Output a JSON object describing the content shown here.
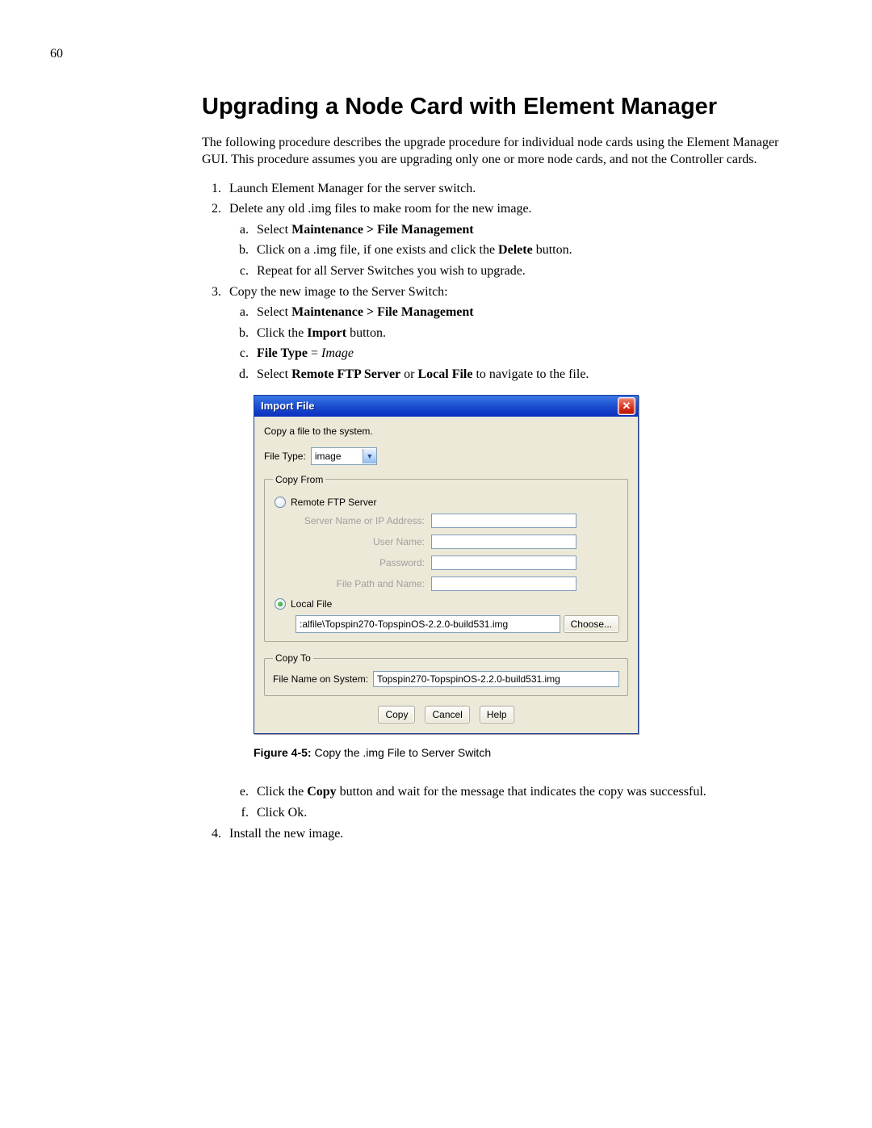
{
  "page_number": "60",
  "heading": "Upgrading a Node Card with Element Manager",
  "intro": "The following procedure describes the upgrade procedure for individual node cards using the Element Manager GUI. This procedure assumes you are upgrading only one or more node cards, and not the Controller cards.",
  "steps": {
    "s1": "Launch Element Manager for the server switch.",
    "s2": "Delete any old .img files to make room for the new image.",
    "s2a_pre": "Select ",
    "s2a_bold": "Maintenance > File Management",
    "s2b_pre": "Click on a .img file, if one exists and click the ",
    "s2b_bold": "Delete",
    "s2b_post": " button.",
    "s2c": "Repeat for all Server Switches you wish to upgrade.",
    "s3": "Copy the new image to the Server Switch:",
    "s3a_pre": "Select ",
    "s3a_bold": "Maintenance > File Management",
    "s3b_pre": "Click the ",
    "s3b_bold": "Import",
    "s3b_post": " button.",
    "s3c_bold": "File Type",
    "s3c_mid": " = ",
    "s3c_italic": "Image",
    "s3d_pre": "Select ",
    "s3d_b1": "Remote FTP Server",
    "s3d_mid": " or ",
    "s3d_b2": "Local File",
    "s3d_post": " to navigate to the file.",
    "s3e_pre": "Click the ",
    "s3e_bold": "Copy",
    "s3e_post": " button and wait for the message that indicates the copy was successful.",
    "s3f": "Click Ok.",
    "s4": "Install the new image."
  },
  "dialog": {
    "title": "Import File",
    "desc": "Copy a file to the system.",
    "file_type_label": "File Type:",
    "file_type_value": "image",
    "copy_from_legend": "Copy From",
    "remote_label": "Remote FTP Server",
    "server_label": "Server Name or IP Address:",
    "user_label": "User Name:",
    "pass_label": "Password:",
    "path_label": "File Path and Name:",
    "local_label": "Local File",
    "local_value": ":alfile\\Topspin270-TopspinOS-2.2.0-build531.img",
    "choose_btn": "Choose...",
    "copy_to_legend": "Copy To",
    "filename_label": "File Name on System:",
    "filename_value": "Topspin270-TopspinOS-2.2.0-build531.img",
    "btn_copy": "Copy",
    "btn_cancel": "Cancel",
    "btn_help": "Help"
  },
  "figure_caption_bold": "Figure 4-5:",
  "figure_caption_rest": " Copy the .img File to Server Switch"
}
